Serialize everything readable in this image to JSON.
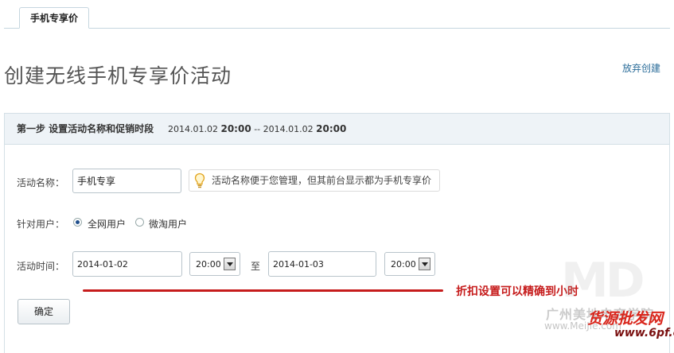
{
  "tab": {
    "label": "手机专享价"
  },
  "page_title": "创建无线手机专享价活动",
  "abandon_link": "放弃创建",
  "step": {
    "label": "第一步  设置活动名称和促销时段",
    "start_date": "2014.01.02",
    "start_time": "20:00",
    "separator": "--",
    "end_date": "2014.01.02",
    "end_time": "20:00"
  },
  "form": {
    "name_label": "活动名称：",
    "name_value": "手机专享",
    "name_hint": "活动名称便于您管理，但其前台显示都为手机专享价",
    "target_label": "针对用户：",
    "target_options": [
      "全网用户",
      "微淘用户"
    ],
    "target_selected": "全网用户",
    "time_label": "活动时间：",
    "start_date": "2014-01-02",
    "start_time": "20:00",
    "to_text": "至",
    "end_date": "2014-01-03",
    "end_time": "20:00"
  },
  "annotation": "折扣设置可以精确到小时",
  "confirm_button": "确定",
  "watermark": {
    "logo": "MD",
    "line1": "广州美地电商学院",
    "line2": "www.MeiJie.com",
    "line3": "货源批发网",
    "line4": "www.6pf.cn"
  },
  "colors": {
    "accent_link": "#2a6c99",
    "annotation_red": "#c61c1c",
    "panel_header": "#eef3f7"
  }
}
